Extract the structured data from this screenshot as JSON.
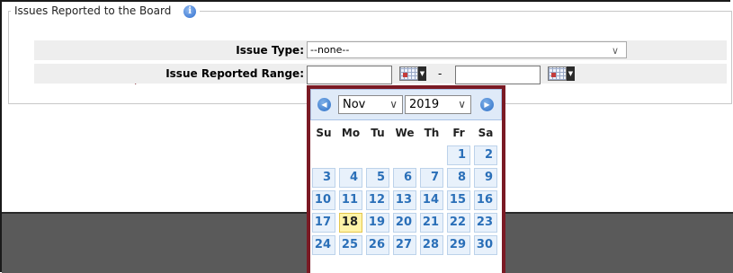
{
  "panel": {
    "legend": "Issues Reported to the Board",
    "info_icon": "info-icon"
  },
  "form": {
    "issue_type_label": "Issue Type:",
    "issue_type_value": "--none--",
    "range_label": "Issue Reported Range:",
    "range_separator": "-",
    "from_value": "",
    "to_value": ""
  },
  "calendar": {
    "prev_icon": "prev-month-icon",
    "next_icon": "next-month-icon",
    "month": "Nov",
    "year": "2019",
    "weekdays": [
      "Su",
      "Mo",
      "Tu",
      "We",
      "Th",
      "Fr",
      "Sa"
    ],
    "weeks": [
      [
        "",
        "",
        "",
        "",
        "",
        "1",
        "2"
      ],
      [
        "3",
        "4",
        "5",
        "6",
        "7",
        "8",
        "9"
      ],
      [
        "10",
        "11",
        "12",
        "13",
        "14",
        "15",
        "16"
      ],
      [
        "17",
        "18",
        "19",
        "20",
        "21",
        "22",
        "23"
      ],
      [
        "24",
        "25",
        "26",
        "27",
        "28",
        "29",
        "30"
      ]
    ],
    "today": "18"
  },
  "colors": {
    "calendar_border": "#7a1a24",
    "arrow": "#7a1a24",
    "today_bg": "#fff3a8",
    "day_text": "#2a6fb8"
  }
}
